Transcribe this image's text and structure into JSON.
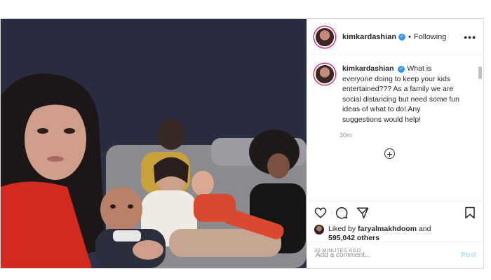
{
  "post": {
    "username": "kimkardashian",
    "verified_mark": "✓",
    "separator": "•",
    "follow_status": "Following",
    "more_glyph": "•••",
    "caption_user": "kimkardashian",
    "caption": "What is everyone doing to keep your kids entertained??? As a family we are social distancing but need some fun ideas of what to do! Any suggestions would help!",
    "caption_time": "30m",
    "load_more_glyph": "+",
    "likes_prefix": "Liked by",
    "likes_user": "faryalmakhdoom",
    "likes_and": "and",
    "likes_count": "595,042 others",
    "timestamp": "30 MINUTES AGO",
    "comment_placeholder": "Add a comment...",
    "post_label": "Post"
  },
  "icons": {
    "like": "heart-icon",
    "comment": "comment-icon",
    "share": "share-icon",
    "save": "bookmark-icon",
    "more": "more-options-icon",
    "add": "plus-circle-icon"
  },
  "colors": {
    "verified": "#3897f0",
    "post_disabled": "#b2dffc",
    "secondary_text": "#8e8e8e",
    "primary_text": "#262626"
  }
}
